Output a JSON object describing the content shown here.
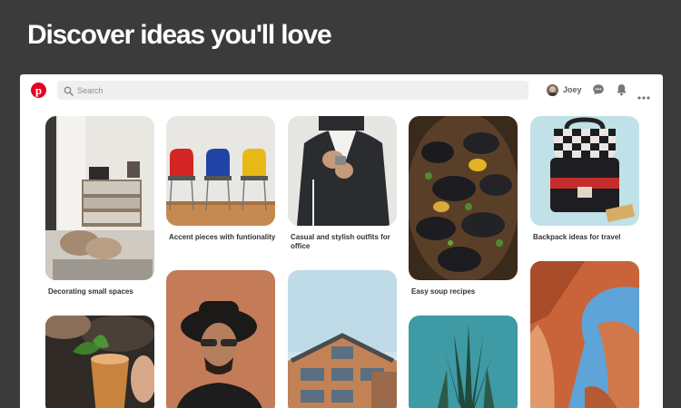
{
  "headline": "Discover ideas you'll love",
  "app": {
    "logo": "pinterest-logo-icon",
    "search": {
      "placeholder": "Search",
      "value": ""
    },
    "profile": {
      "name": "Joey"
    },
    "icons": [
      "message-icon",
      "notification-bell-icon",
      "more-options-icon"
    ],
    "accent_color": "#e60023"
  },
  "pins": [
    {
      "id": "decorating",
      "caption": "Decorating small spaces"
    },
    {
      "id": "chairs",
      "caption": "Accent pieces with funtionality"
    },
    {
      "id": "outfit",
      "caption": "Casual and stylish outfits for office"
    },
    {
      "id": "soup",
      "caption": "Easy soup recipes"
    },
    {
      "id": "backpack",
      "caption": "Backpack ideas for travel"
    },
    {
      "id": "cocktail",
      "caption": ""
    },
    {
      "id": "man-hat",
      "caption": ""
    },
    {
      "id": "building",
      "caption": ""
    },
    {
      "id": "plant",
      "caption": ""
    },
    {
      "id": "canyon",
      "caption": ""
    }
  ]
}
